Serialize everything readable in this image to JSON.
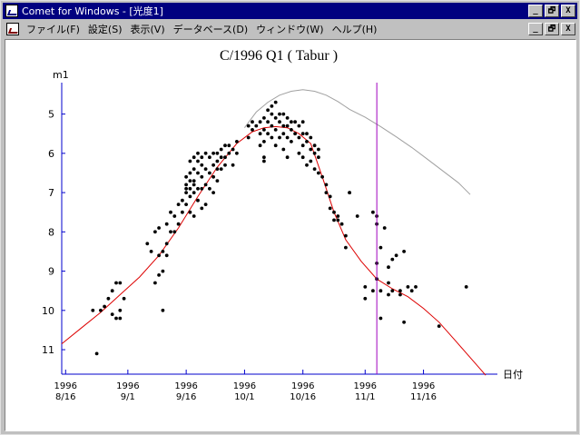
{
  "window": {
    "title": "Comet for Windows - [光度1]",
    "buttons": [
      "_",
      "🗗",
      "X"
    ]
  },
  "menubar": {
    "items": [
      "ファイル(F)",
      "設定(S)",
      "表示(V)",
      "データベース(D)",
      "ウィンドウ(W)",
      "ヘルプ(H)"
    ],
    "buttons": [
      "_",
      "🗗",
      "X"
    ]
  },
  "colors": {
    "observations": "#000000",
    "model_curve": "#dd0000",
    "reference_curve": "#a0a0a0",
    "current_date_line": "#a000c0",
    "axis": "#0000cc"
  },
  "chart_data": {
    "type": "scatter",
    "title": "C/1996 Q1 ( Tabur )",
    "ylabel": "m1",
    "xlabel": "日付",
    "y_inverted": true,
    "ylim": [
      11.6,
      4.2
    ],
    "xlim": [
      "1996-08-15",
      "1996-12-05"
    ],
    "y_ticks": [
      5,
      6,
      7,
      8,
      9,
      10,
      11
    ],
    "x_ticks": [
      {
        "date": "1996-08-16",
        "year": "1996",
        "md": "8/16"
      },
      {
        "date": "1996-09-01",
        "year": "1996",
        "md": "9/1"
      },
      {
        "date": "1996-09-16",
        "year": "1996",
        "md": "9/16"
      },
      {
        "date": "1996-10-01",
        "year": "1996",
        "md": "10/1"
      },
      {
        "date": "1996-10-16",
        "year": "1996",
        "md": "10/16"
      },
      {
        "date": "1996-11-01",
        "year": "1996",
        "md": "11/1"
      },
      {
        "date": "1996-11-16",
        "year": "1996",
        "md": "11/16"
      }
    ],
    "current_date": "1996-11-04",
    "series": [
      {
        "kind": "points",
        "points": [
          [
            "1996-08-23",
            10.0
          ],
          [
            "1996-08-24",
            11.1
          ],
          [
            "1996-08-25",
            10.0
          ],
          [
            "1996-08-26",
            9.9
          ],
          [
            "1996-08-27",
            9.7
          ],
          [
            "1996-08-28",
            10.1
          ],
          [
            "1996-08-28",
            9.5
          ],
          [
            "1996-08-29",
            9.3
          ],
          [
            "1996-08-29",
            10.2
          ],
          [
            "1996-08-30",
            9.3
          ],
          [
            "1996-08-30",
            10.0
          ],
          [
            "1996-08-30",
            10.2
          ],
          [
            "1996-08-31",
            9.7
          ],
          [
            "1996-09-06",
            8.3
          ],
          [
            "1996-09-07",
            8.5
          ],
          [
            "1996-09-08",
            8.0
          ],
          [
            "1996-09-08",
            9.3
          ],
          [
            "1996-09-09",
            7.9
          ],
          [
            "1996-09-09",
            8.6
          ],
          [
            "1996-09-09",
            9.1
          ],
          [
            "1996-09-10",
            8.5
          ],
          [
            "1996-09-10",
            9.0
          ],
          [
            "1996-09-10",
            10.0
          ],
          [
            "1996-09-11",
            7.8
          ],
          [
            "1996-09-11",
            8.3
          ],
          [
            "1996-09-11",
            8.6
          ],
          [
            "1996-09-12",
            8.0
          ],
          [
            "1996-09-12",
            7.5
          ],
          [
            "1996-09-13",
            7.6
          ],
          [
            "1996-09-13",
            8.0
          ],
          [
            "1996-09-14",
            7.8
          ],
          [
            "1996-09-14",
            7.3
          ],
          [
            "1996-09-15",
            7.5
          ],
          [
            "1996-09-15",
            7.2
          ],
          [
            "1996-09-16",
            6.6
          ],
          [
            "1996-09-16",
            7.0
          ],
          [
            "1996-09-16",
            7.3
          ],
          [
            "1996-09-16",
            6.8
          ],
          [
            "1996-09-16",
            6.9
          ],
          [
            "1996-09-17",
            6.5
          ],
          [
            "1996-09-17",
            6.7
          ],
          [
            "1996-09-17",
            6.9
          ],
          [
            "1996-09-17",
            7.1
          ],
          [
            "1996-09-17",
            7.5
          ],
          [
            "1996-09-17",
            6.2
          ],
          [
            "1996-09-18",
            6.1
          ],
          [
            "1996-09-18",
            6.4
          ],
          [
            "1996-09-18",
            6.7
          ],
          [
            "1996-09-18",
            7.0
          ],
          [
            "1996-09-18",
            6.8
          ],
          [
            "1996-09-18",
            7.6
          ],
          [
            "1996-09-19",
            6.0
          ],
          [
            "1996-09-19",
            6.2
          ],
          [
            "1996-09-19",
            6.5
          ],
          [
            "1996-09-19",
            6.9
          ],
          [
            "1996-09-19",
            7.2
          ],
          [
            "1996-09-20",
            6.1
          ],
          [
            "1996-09-20",
            6.3
          ],
          [
            "1996-09-20",
            6.6
          ],
          [
            "1996-09-20",
            6.9
          ],
          [
            "1996-09-20",
            7.4
          ],
          [
            "1996-09-21",
            6.0
          ],
          [
            "1996-09-21",
            6.4
          ],
          [
            "1996-09-21",
            6.8
          ],
          [
            "1996-09-21",
            7.3
          ],
          [
            "1996-09-22",
            6.1
          ],
          [
            "1996-09-22",
            6.5
          ],
          [
            "1996-09-22",
            6.9
          ],
          [
            "1996-09-23",
            6.0
          ],
          [
            "1996-09-23",
            6.3
          ],
          [
            "1996-09-23",
            6.6
          ],
          [
            "1996-09-23",
            7.0
          ],
          [
            "1996-09-24",
            6.0
          ],
          [
            "1996-09-24",
            6.2
          ],
          [
            "1996-09-24",
            6.4
          ],
          [
            "1996-09-24",
            6.7
          ],
          [
            "1996-09-25",
            5.9
          ],
          [
            "1996-09-25",
            6.1
          ],
          [
            "1996-09-25",
            6.4
          ],
          [
            "1996-09-26",
            5.8
          ],
          [
            "1996-09-26",
            6.1
          ],
          [
            "1996-09-26",
            6.3
          ],
          [
            "1996-09-27",
            5.8
          ],
          [
            "1996-09-27",
            6.0
          ],
          [
            "1996-09-28",
            5.9
          ],
          [
            "1996-09-28",
            6.3
          ],
          [
            "1996-09-29",
            5.7
          ],
          [
            "1996-09-29",
            6.0
          ],
          [
            "1996-10-02",
            5.3
          ],
          [
            "1996-10-02",
            5.6
          ],
          [
            "1996-10-03",
            5.2
          ],
          [
            "1996-10-03",
            5.4
          ],
          [
            "1996-10-04",
            5.3
          ],
          [
            "1996-10-05",
            5.2
          ],
          [
            "1996-10-05",
            5.5
          ],
          [
            "1996-10-05",
            5.8
          ],
          [
            "1996-10-06",
            5.1
          ],
          [
            "1996-10-06",
            5.4
          ],
          [
            "1996-10-06",
            5.7
          ],
          [
            "1996-10-06",
            6.1
          ],
          [
            "1996-10-06",
            6.2
          ],
          [
            "1996-10-07",
            4.9
          ],
          [
            "1996-10-07",
            5.2
          ],
          [
            "1996-10-07",
            5.5
          ],
          [
            "1996-10-08",
            4.8
          ],
          [
            "1996-10-08",
            5.0
          ],
          [
            "1996-10-08",
            5.3
          ],
          [
            "1996-10-08",
            5.6
          ],
          [
            "1996-10-09",
            4.7
          ],
          [
            "1996-10-09",
            5.1
          ],
          [
            "1996-10-09",
            5.4
          ],
          [
            "1996-10-09",
            5.8
          ],
          [
            "1996-10-10",
            5.0
          ],
          [
            "1996-10-10",
            5.2
          ],
          [
            "1996-10-10",
            5.6
          ],
          [
            "1996-10-11",
            5.0
          ],
          [
            "1996-10-11",
            5.3
          ],
          [
            "1996-10-11",
            5.5
          ],
          [
            "1996-10-11",
            5.9
          ],
          [
            "1996-10-12",
            5.1
          ],
          [
            "1996-10-12",
            5.3
          ],
          [
            "1996-10-12",
            5.6
          ],
          [
            "1996-10-12",
            6.1
          ],
          [
            "1996-10-13",
            5.2
          ],
          [
            "1996-10-13",
            5.4
          ],
          [
            "1996-10-13",
            5.7
          ],
          [
            "1996-10-14",
            5.2
          ],
          [
            "1996-10-14",
            5.5
          ],
          [
            "1996-10-15",
            5.3
          ],
          [
            "1996-10-15",
            5.6
          ],
          [
            "1996-10-15",
            6.0
          ],
          [
            "1996-10-16",
            5.2
          ],
          [
            "1996-10-16",
            5.5
          ],
          [
            "1996-10-16",
            5.8
          ],
          [
            "1996-10-16",
            6.1
          ],
          [
            "1996-10-17",
            5.5
          ],
          [
            "1996-10-17",
            5.7
          ],
          [
            "1996-10-17",
            6.3
          ],
          [
            "1996-10-18",
            5.6
          ],
          [
            "1996-10-18",
            5.9
          ],
          [
            "1996-10-18",
            6.2
          ],
          [
            "1996-10-19",
            5.8
          ],
          [
            "1996-10-19",
            6.0
          ],
          [
            "1996-10-19",
            6.4
          ],
          [
            "1996-10-20",
            5.9
          ],
          [
            "1996-10-20",
            6.1
          ],
          [
            "1996-10-20",
            6.5
          ],
          [
            "1996-10-21",
            6.6
          ],
          [
            "1996-10-22",
            6.8
          ],
          [
            "1996-10-22",
            7.0
          ],
          [
            "1996-10-23",
            7.1
          ],
          [
            "1996-10-23",
            7.4
          ],
          [
            "1996-10-24",
            7.5
          ],
          [
            "1996-10-24",
            7.7
          ],
          [
            "1996-10-25",
            7.6
          ],
          [
            "1996-10-25",
            7.7
          ],
          [
            "1996-10-26",
            7.8
          ],
          [
            "1996-10-27",
            8.1
          ],
          [
            "1996-10-27",
            8.4
          ],
          [
            "1996-10-28",
            7.0
          ],
          [
            "1996-10-28",
            7.0
          ],
          [
            "1996-10-30",
            7.6
          ],
          [
            "1996-11-01",
            9.4
          ],
          [
            "1996-11-01",
            9.7
          ],
          [
            "1996-11-03",
            7.5
          ],
          [
            "1996-11-03",
            9.5
          ],
          [
            "1996-11-04",
            7.6
          ],
          [
            "1996-11-04",
            7.8
          ],
          [
            "1996-11-04",
            8.8
          ],
          [
            "1996-11-04",
            9.2
          ],
          [
            "1996-11-05",
            8.4
          ],
          [
            "1996-11-05",
            9.5
          ],
          [
            "1996-11-05",
            10.2
          ],
          [
            "1996-11-06",
            7.9
          ],
          [
            "1996-11-07",
            8.9
          ],
          [
            "1996-11-07",
            9.3
          ],
          [
            "1996-11-07",
            9.6
          ],
          [
            "1996-11-08",
            8.7
          ],
          [
            "1996-11-08",
            9.5
          ],
          [
            "1996-11-09",
            8.6
          ],
          [
            "1996-11-10",
            9.5
          ],
          [
            "1996-11-10",
            9.6
          ],
          [
            "1996-11-11",
            8.5
          ],
          [
            "1996-11-11",
            10.3
          ],
          [
            "1996-11-12",
            9.4
          ],
          [
            "1996-11-13",
            9.5
          ],
          [
            "1996-11-14",
            9.4
          ],
          [
            "1996-11-20",
            10.4
          ],
          [
            "1996-11-27",
            9.4
          ]
        ]
      },
      {
        "kind": "curve",
        "color": "#dd0000",
        "points": [
          [
            "1996-08-15",
            10.85
          ],
          [
            "1996-08-20",
            10.45
          ],
          [
            "1996-08-25",
            10.05
          ],
          [
            "1996-08-30",
            9.6
          ],
          [
            "1996-09-04",
            9.15
          ],
          [
            "1996-09-09",
            8.6
          ],
          [
            "1996-09-14",
            7.9
          ],
          [
            "1996-09-19",
            7.1
          ],
          [
            "1996-09-24",
            6.35
          ],
          [
            "1996-09-29",
            5.75
          ],
          [
            "1996-10-03",
            5.45
          ],
          [
            "1996-10-06",
            5.35
          ],
          [
            "1996-10-09",
            5.32
          ],
          [
            "1996-10-12",
            5.35
          ],
          [
            "1996-10-15",
            5.5
          ],
          [
            "1996-10-18",
            5.75
          ],
          [
            "1996-10-21",
            6.6
          ],
          [
            "1996-10-24",
            7.5
          ],
          [
            "1996-10-27",
            8.2
          ],
          [
            "1996-10-31",
            8.75
          ],
          [
            "1996-11-04",
            9.2
          ],
          [
            "1996-11-08",
            9.45
          ],
          [
            "1996-11-12",
            9.65
          ],
          [
            "1996-11-16",
            9.95
          ],
          [
            "1996-11-20",
            10.3
          ],
          [
            "1996-11-24",
            10.75
          ],
          [
            "1996-11-28",
            11.2
          ],
          [
            "1996-12-02",
            11.65
          ]
        ]
      },
      {
        "kind": "curve",
        "color": "#a0a0a0",
        "points": [
          [
            "1996-10-01",
            5.35
          ],
          [
            "1996-10-04",
            4.95
          ],
          [
            "1996-10-07",
            4.7
          ],
          [
            "1996-10-10",
            4.52
          ],
          [
            "1996-10-13",
            4.42
          ],
          [
            "1996-10-16",
            4.38
          ],
          [
            "1996-10-19",
            4.42
          ],
          [
            "1996-10-22",
            4.52
          ],
          [
            "1996-10-25",
            4.68
          ],
          [
            "1996-10-28",
            4.88
          ],
          [
            "1996-11-01",
            5.08
          ],
          [
            "1996-11-05",
            5.32
          ],
          [
            "1996-11-09",
            5.58
          ],
          [
            "1996-11-13",
            5.85
          ],
          [
            "1996-11-17",
            6.15
          ],
          [
            "1996-11-21",
            6.45
          ],
          [
            "1996-11-25",
            6.75
          ],
          [
            "1996-11-28",
            7.05
          ]
        ]
      }
    ]
  }
}
